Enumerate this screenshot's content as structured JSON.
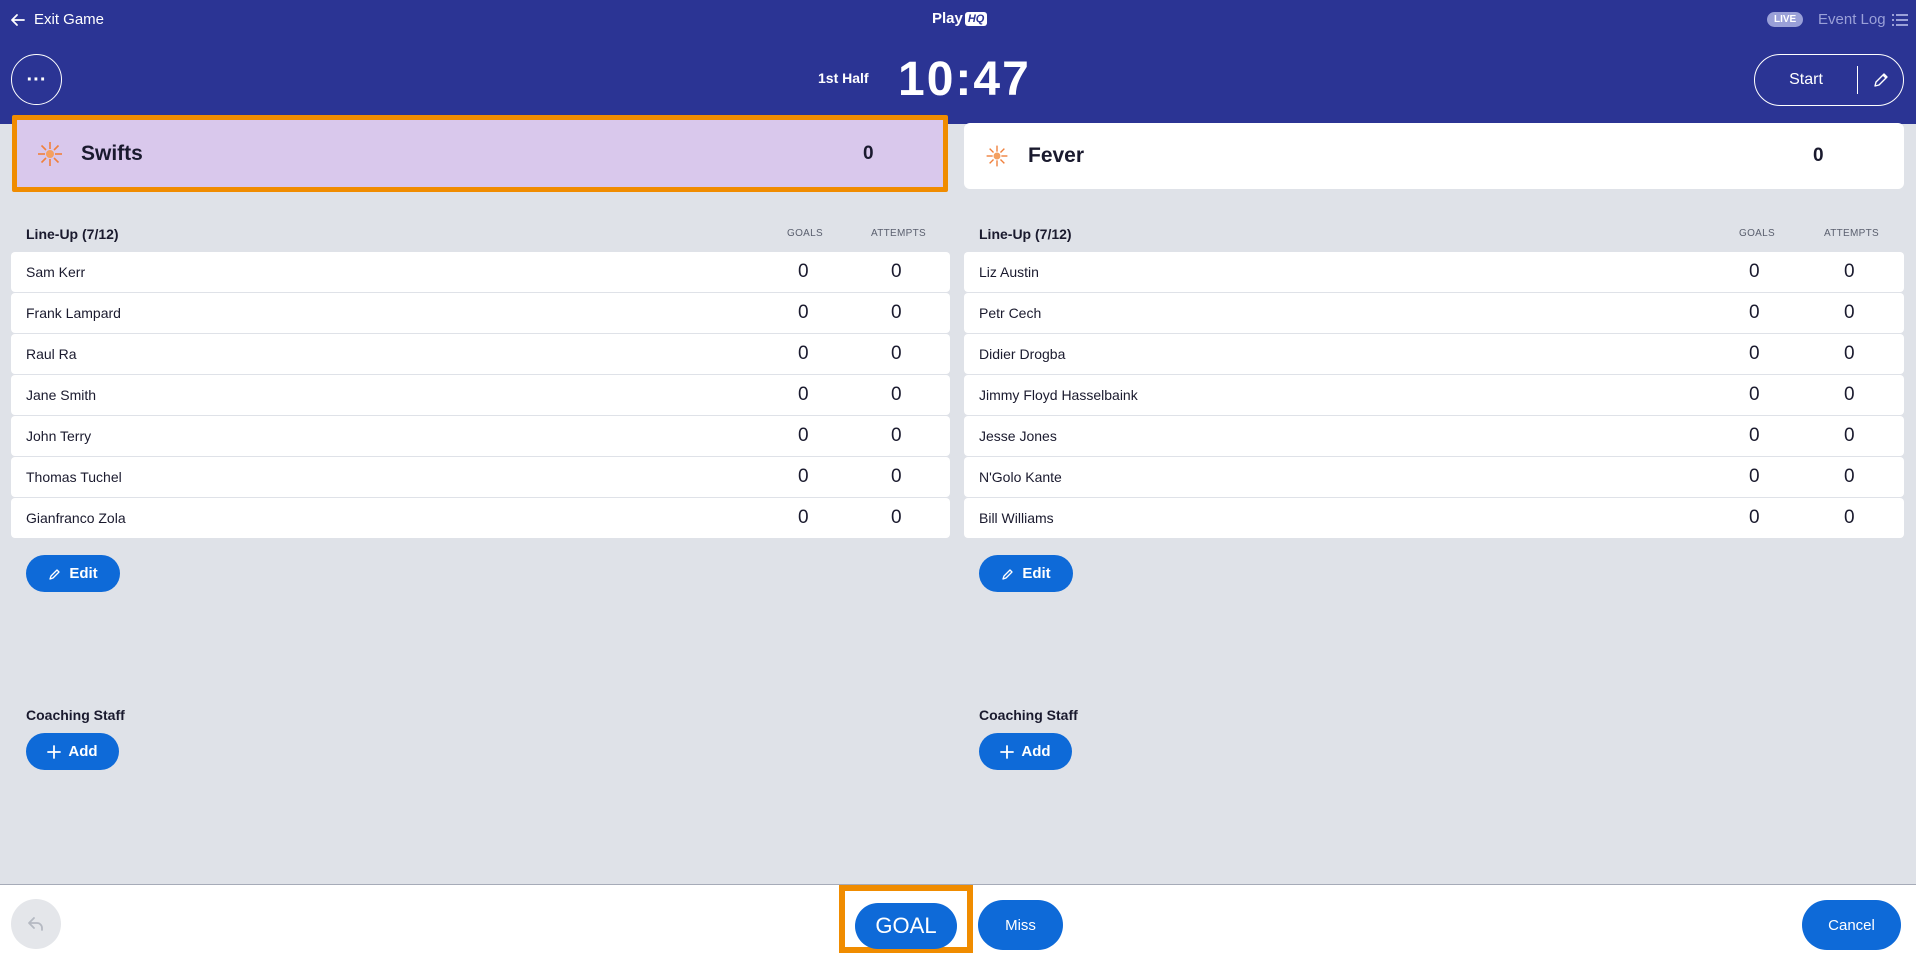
{
  "header": {
    "exit_label": "Exit Game",
    "logo_text": "Play",
    "logo_badge": "HQ",
    "live_badge": "LIVE",
    "event_log_label": "Event Log",
    "more_label": "···",
    "period": "1st Half",
    "clock": "10:47",
    "start_label": "Start"
  },
  "teams": {
    "home": {
      "name": "Swifts",
      "score": "0",
      "logo_text": "netball"
    },
    "away": {
      "name": "Fever",
      "score": "0"
    }
  },
  "lineup": {
    "home": {
      "title": "Line-Up (7/12)",
      "col_goals": "GOALS",
      "col_attempts": "ATTEMPTS",
      "players": [
        {
          "name": "Sam Kerr",
          "goals": "0",
          "attempts": "0"
        },
        {
          "name": "Frank Lampard",
          "goals": "0",
          "attempts": "0"
        },
        {
          "name": "Raul Ra",
          "goals": "0",
          "attempts": "0"
        },
        {
          "name": "Jane Smith",
          "goals": "0",
          "attempts": "0"
        },
        {
          "name": "John Terry",
          "goals": "0",
          "attempts": "0"
        },
        {
          "name": "Thomas Tuchel",
          "goals": "0",
          "attempts": "0"
        },
        {
          "name": "Gianfranco Zola",
          "goals": "0",
          "attempts": "0"
        }
      ],
      "edit_label": "Edit",
      "staff_title": "Coaching Staff",
      "add_label": "Add"
    },
    "away": {
      "title": "Line-Up (7/12)",
      "col_goals": "GOALS",
      "col_attempts": "ATTEMPTS",
      "players": [
        {
          "name": "Liz Austin",
          "goals": "0",
          "attempts": "0"
        },
        {
          "name": "Petr Cech",
          "goals": "0",
          "attempts": "0"
        },
        {
          "name": "Didier Drogba",
          "goals": "0",
          "attempts": "0"
        },
        {
          "name": "Jimmy Floyd Hasselbaink",
          "goals": "0",
          "attempts": "0"
        },
        {
          "name": "Jesse Jones",
          "goals": "0",
          "attempts": "0"
        },
        {
          "name": "N'Golo Kante",
          "goals": "0",
          "attempts": "0"
        },
        {
          "name": "Bill Williams",
          "goals": "0",
          "attempts": "0"
        }
      ],
      "edit_label": "Edit",
      "staff_title": "Coaching Staff",
      "add_label": "Add"
    }
  },
  "footer": {
    "goal_label": "GOAL",
    "miss_label": "Miss",
    "cancel_label": "Cancel"
  },
  "colors": {
    "header_bg": "#2b3494",
    "accent_blue": "#0e6ad8",
    "highlight_orange": "#f08c00",
    "home_card_bg": "#d9c8ec",
    "page_bg": "#dfe2e8"
  },
  "icons": {
    "exit": "arrow-left-icon",
    "event_log": "list-icon",
    "edit_clock": "pencil-icon",
    "undo": "undo-icon",
    "edit": "pencil-icon",
    "add": "plus-icon",
    "team_logo": "sunburst-logo-icon"
  }
}
